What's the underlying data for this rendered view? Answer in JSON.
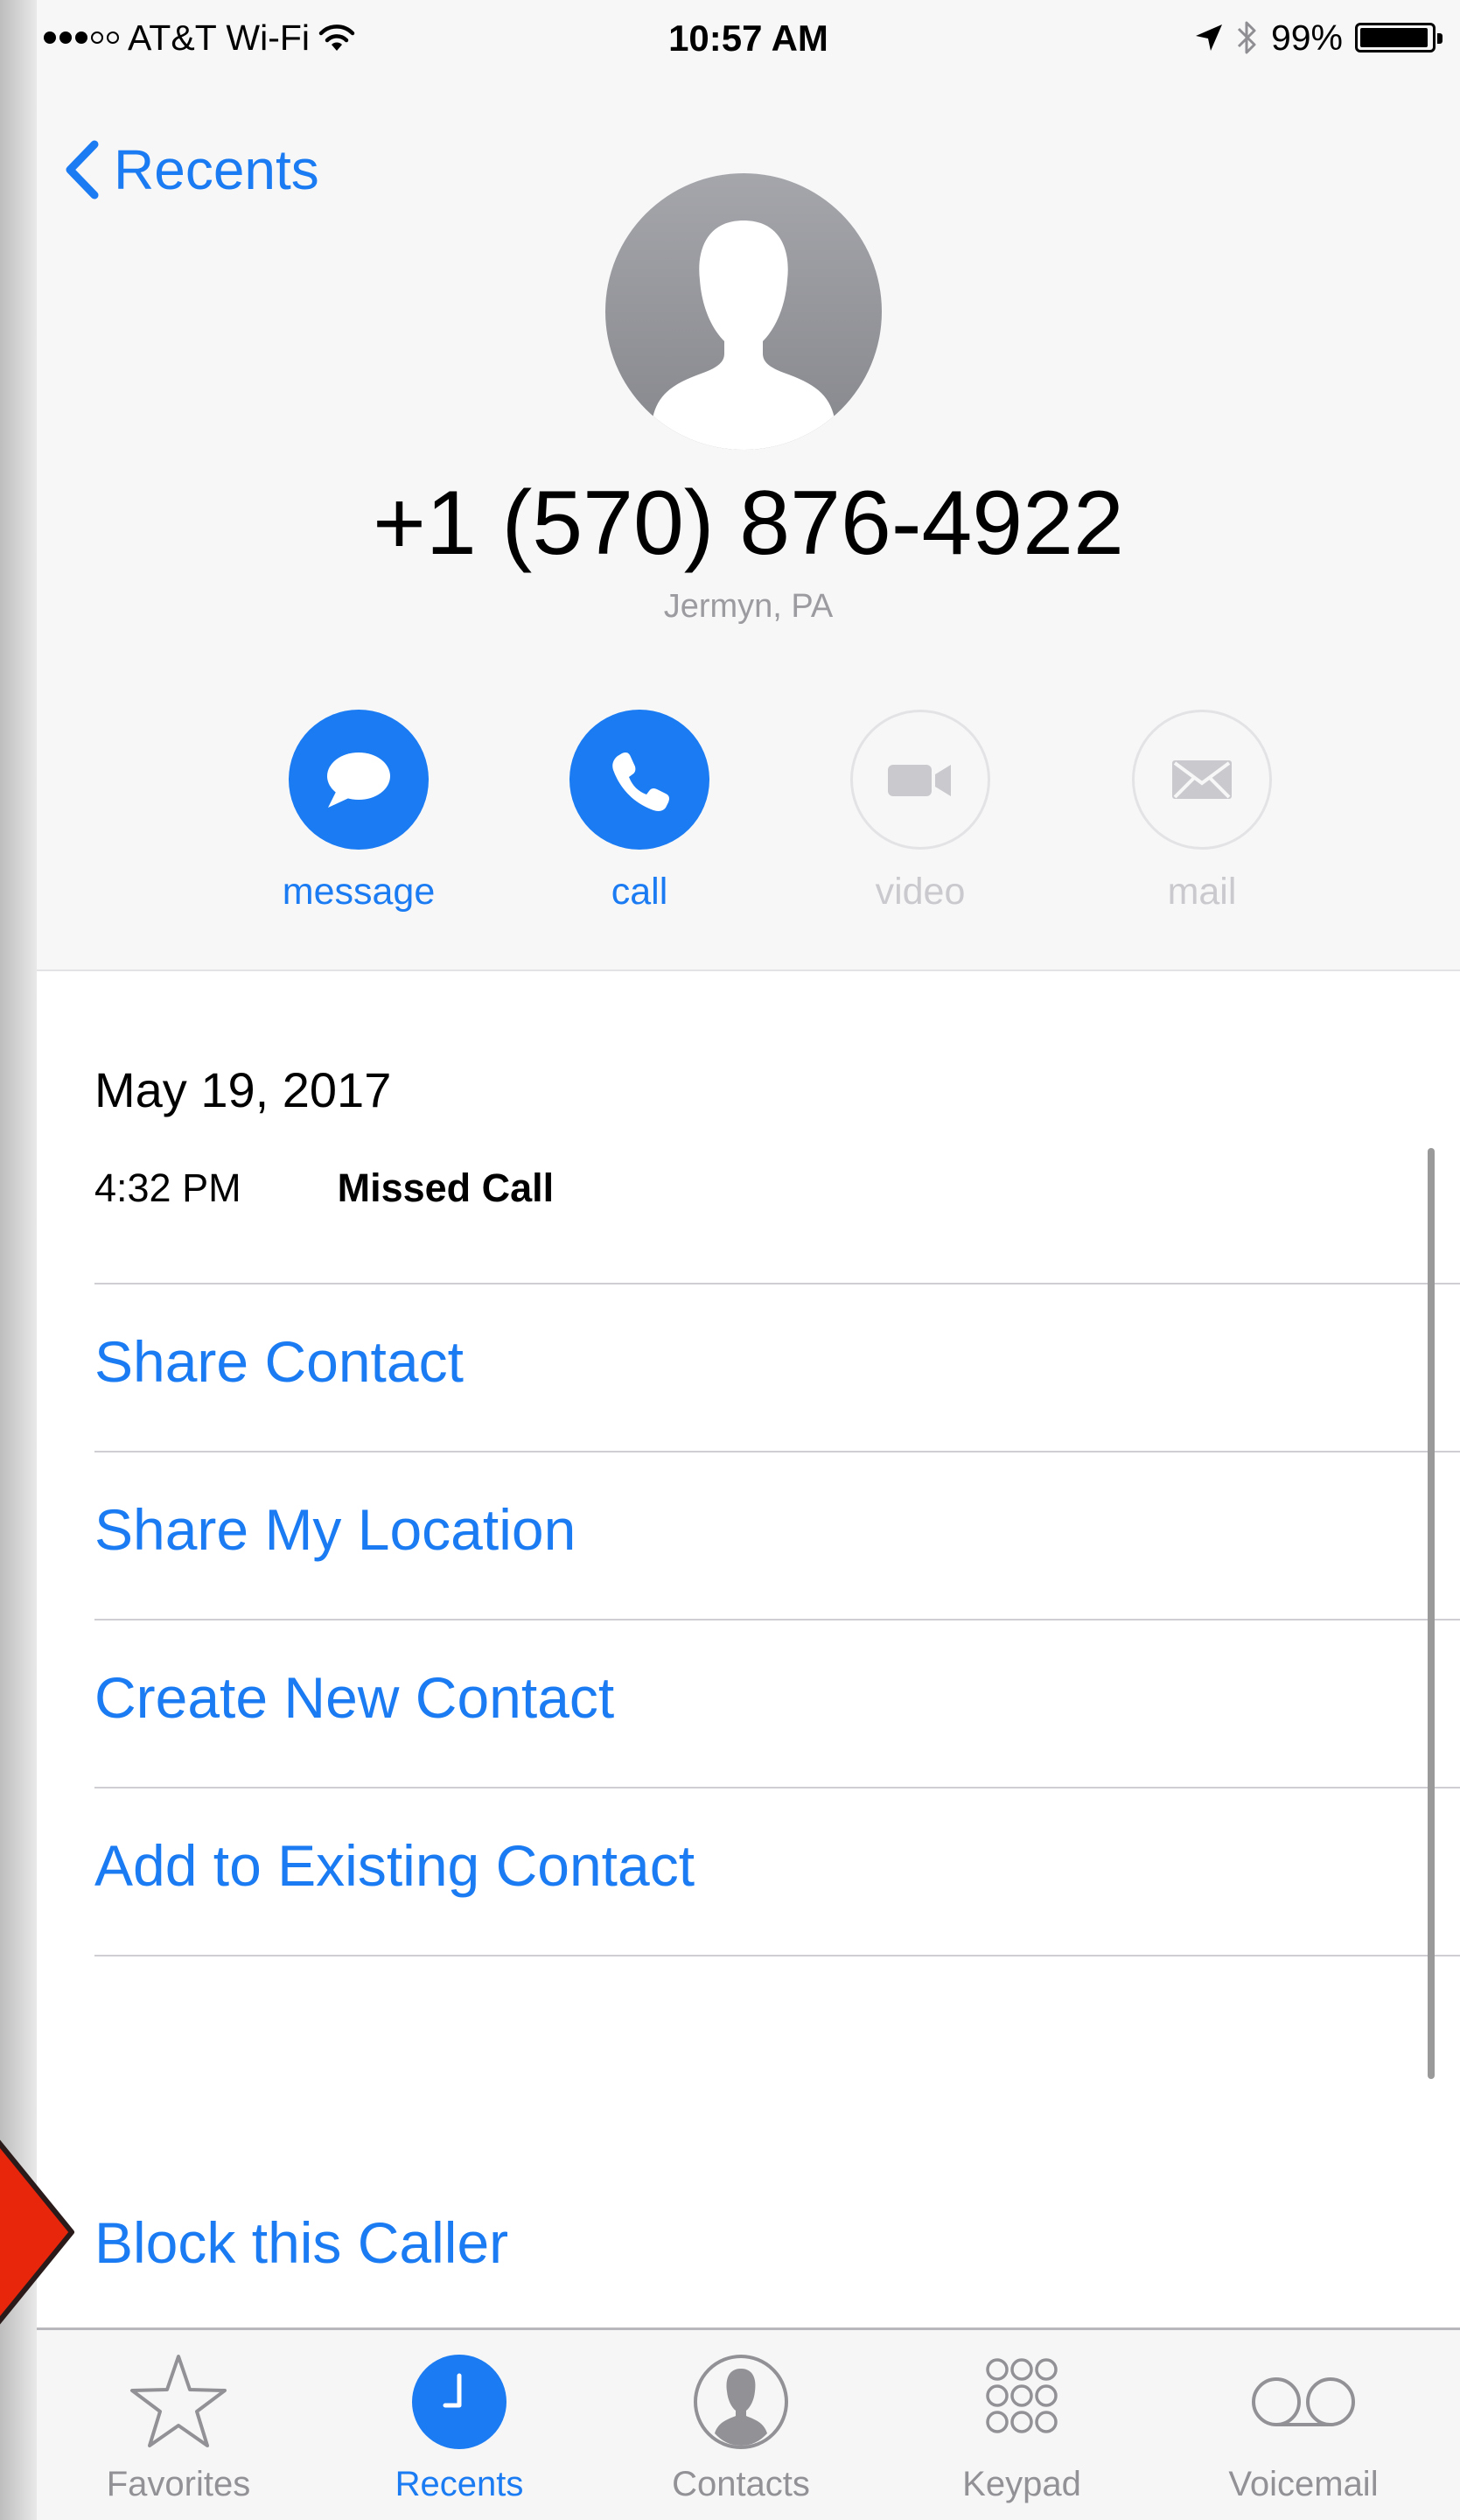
{
  "status_bar": {
    "carrier": "AT&T Wi-Fi",
    "time": "10:57 AM",
    "battery": "99%",
    "icons": [
      "signal-dots-icon",
      "wifi-icon",
      "location-arrow-icon",
      "bluetooth-icon",
      "battery-icon"
    ]
  },
  "nav": {
    "back_label": "Recents"
  },
  "contact": {
    "number": "+1 (570) 876-4922",
    "location": "Jermyn, PA"
  },
  "actions": [
    {
      "label": "message",
      "icon": "message-bubble-icon",
      "enabled": true
    },
    {
      "label": "call",
      "icon": "phone-icon",
      "enabled": true
    },
    {
      "label": "video",
      "icon": "video-camera-icon",
      "enabled": false
    },
    {
      "label": "mail",
      "icon": "envelope-icon",
      "enabled": false
    }
  ],
  "history": {
    "date": "May 19, 2017",
    "time": "4:32 PM",
    "type": "Missed Call"
  },
  "menu": {
    "share_contact": "Share Contact",
    "share_location": "Share My Location",
    "create_contact": "Create New Contact",
    "add_existing": "Add to Existing Contact",
    "block": "Block this Caller"
  },
  "tabs": [
    {
      "label": "Favorites",
      "icon": "star-icon",
      "active": false
    },
    {
      "label": "Recents",
      "icon": "clock-icon",
      "active": true
    },
    {
      "label": "Contacts",
      "icon": "person-circle-icon",
      "active": false
    },
    {
      "label": "Keypad",
      "icon": "keypad-icon",
      "active": false
    },
    {
      "label": "Voicemail",
      "icon": "voicemail-icon",
      "active": false
    }
  ],
  "colors": {
    "accent": "#1a7bf2",
    "callout": "#e8260c",
    "disabled": "#cacace"
  }
}
